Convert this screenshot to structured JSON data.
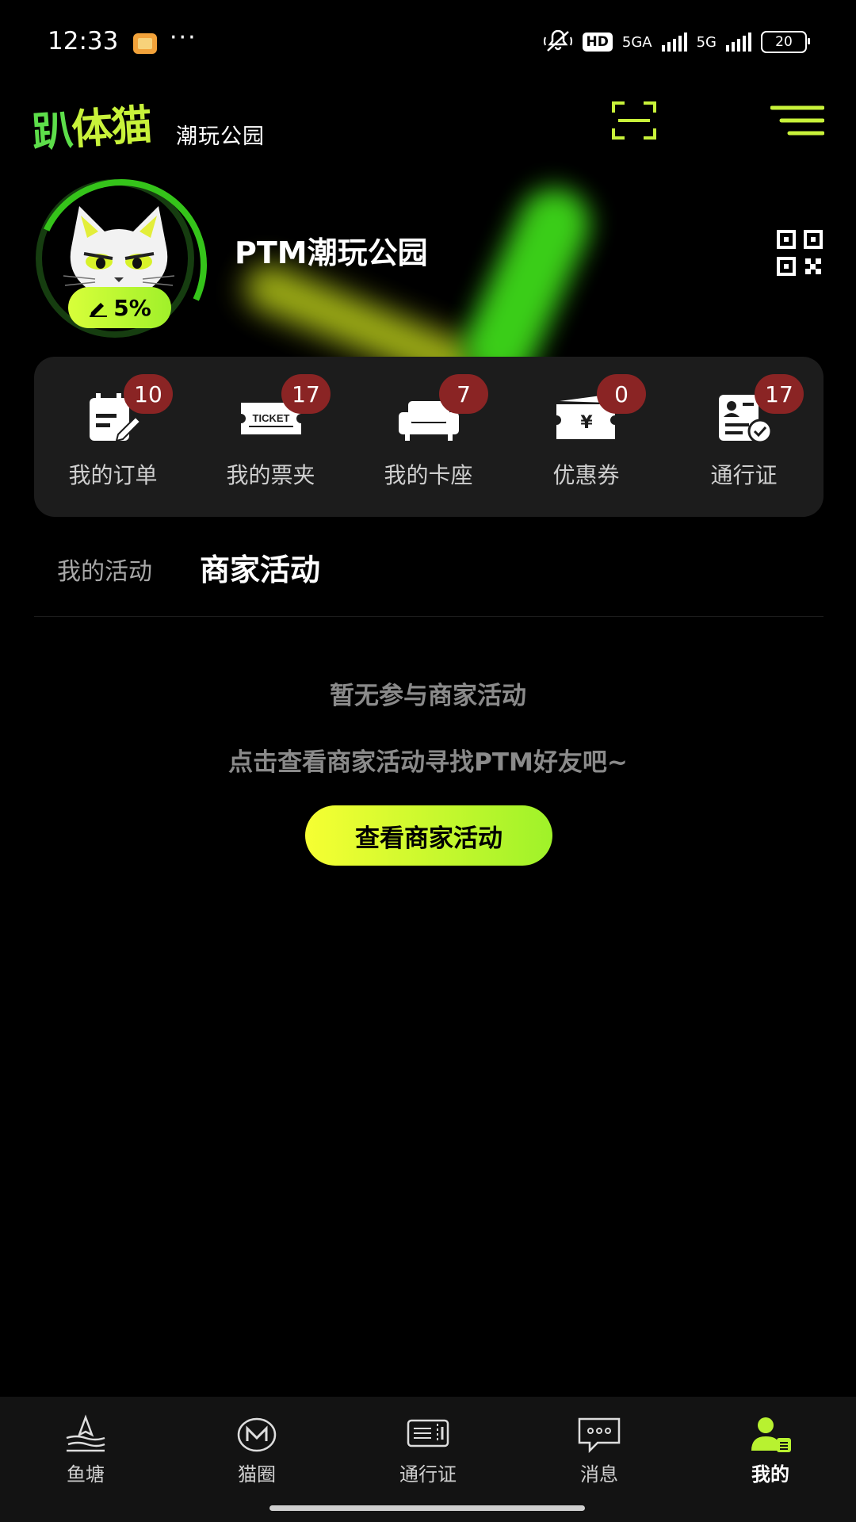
{
  "status_bar": {
    "time": "12:33",
    "more": "···",
    "hd": "HD",
    "net1": "5GA",
    "net2": "5G",
    "battery": "20"
  },
  "header": {
    "logo_text_a": "趴",
    "logo_text_b": "体猫",
    "subtitle": "潮玩公园",
    "scan_icon": "scan-icon",
    "menu_icon": "menu-icon"
  },
  "profile": {
    "name": "PTM潮玩公园",
    "completion": "5%",
    "edit_icon": "pencil-icon",
    "qr_icon": "qr-code-icon",
    "ring_color": "#35c41a",
    "accent": "#c8f23a"
  },
  "quick_items": [
    {
      "label": "我的订单",
      "count": "10",
      "icon": "order-icon"
    },
    {
      "label": "我的票夹",
      "count": "17",
      "icon": "ticket-icon",
      "icon_text": "TICKET"
    },
    {
      "label": "我的卡座",
      "count": "7",
      "icon": "sofa-icon"
    },
    {
      "label": "优惠券",
      "count": "0",
      "icon": "coupon-icon",
      "icon_text": "¥"
    },
    {
      "label": "通行证",
      "count": "17",
      "icon": "pass-icon"
    }
  ],
  "tabs": {
    "mine": "我的活动",
    "merchant": "商家活动",
    "active": "merchant"
  },
  "empty_state": {
    "title": "暂无参与商家活动",
    "description": "点击查看商家活动寻找PTM好友吧~",
    "button": "查看商家活动"
  },
  "bottom_nav": [
    {
      "label": "鱼塘",
      "icon": "pond-icon"
    },
    {
      "label": "猫圈",
      "icon": "cat-circle-icon"
    },
    {
      "label": "通行证",
      "icon": "pass-card-icon"
    },
    {
      "label": "消息",
      "icon": "message-icon"
    },
    {
      "label": "我的",
      "icon": "profile-icon",
      "active": true
    }
  ],
  "colors": {
    "badge": "#8a2424",
    "card_bg": "#1c1c1c",
    "button_gradient_start": "#f6ff33",
    "button_gradient_end": "#9ff229"
  }
}
